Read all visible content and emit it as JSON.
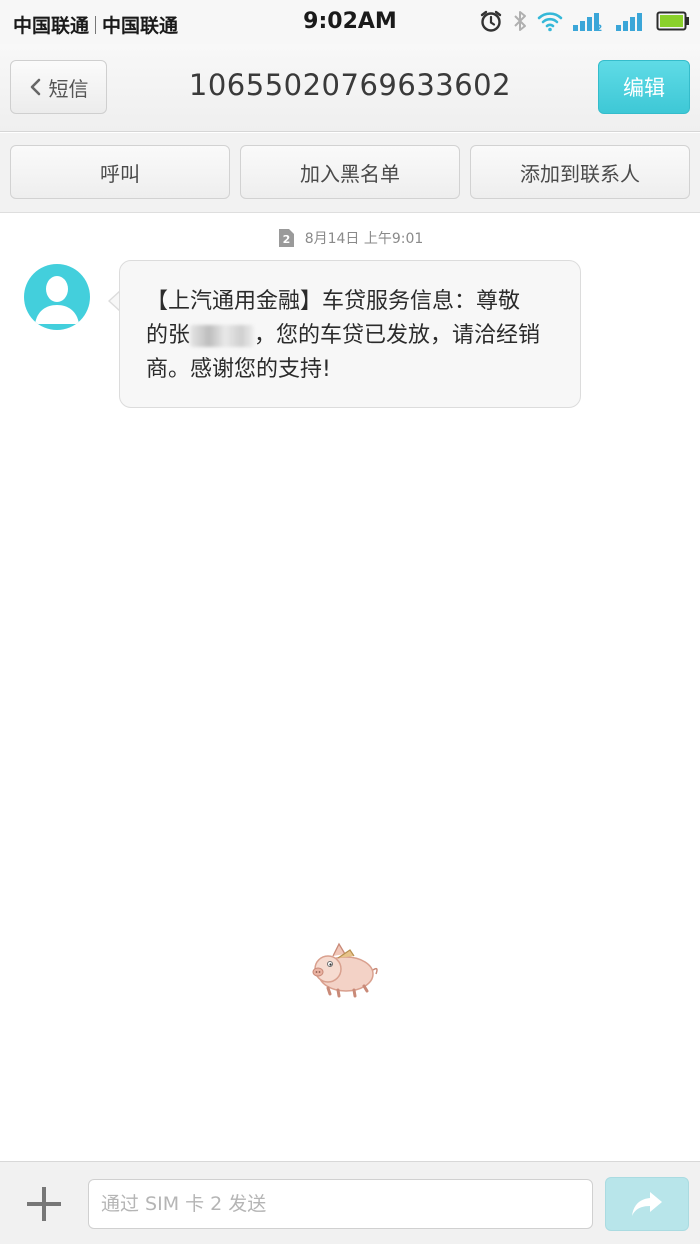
{
  "status_bar": {
    "carrier_1": "中国联通",
    "carrier_2": "中国联通",
    "time": "9:02AM",
    "icons": [
      "alarm-icon",
      "bluetooth-icon",
      "wifi-icon",
      "signal-sim1-icon",
      "signal-sim2-icon",
      "battery-icon"
    ]
  },
  "header": {
    "back_label": "短信",
    "title": "10655020769633602",
    "edit_label": "编辑",
    "accent_color": "#45cfdc"
  },
  "actions": {
    "call_label": "呼叫",
    "blacklist_label": "加入黑名单",
    "add_contact_label": "添加到联系人"
  },
  "conversation": {
    "timestamp": "8月14日 上午9:01",
    "sim_badge": "2",
    "message": {
      "line1": "【上汽通用金融】车贷服务信息：尊敬",
      "line2_prefix": "的张",
      "line2_suffix": "，您的车贷已发放，请洽经销",
      "line3": "商。感谢您的支持!"
    }
  },
  "input_bar": {
    "placeholder": "通过 SIM 卡 2 发送"
  }
}
